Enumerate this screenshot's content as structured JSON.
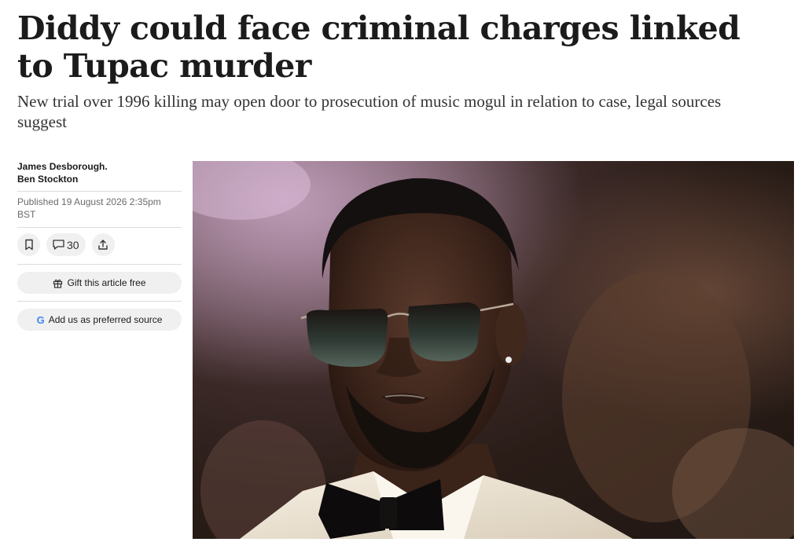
{
  "article": {
    "headline": "Diddy could face criminal charges linked to Tupac murder",
    "standfirst": "New trial over 1996 killing may open door to prosecution of music mogul in relation to case, legal sources suggest",
    "byline_line1": "James Desborough.",
    "byline_line2": "Ben Stockton",
    "published": "Published 19 August 2026 2:35pm BST"
  },
  "actions": {
    "bookmark_icon": "bookmark-icon",
    "comment_icon": "comment-icon",
    "comment_count": "30",
    "share_icon": "share-icon",
    "gift_label": "Gift this article free",
    "gift_icon": "gift-icon",
    "preferred_source_label": "Add us as preferred source",
    "google_icon": "google-icon",
    "google_letter": "G"
  },
  "image": {
    "subject": "photo-of-man-in-sunglasses-and-white-tuxedo"
  },
  "colors": {
    "text": "#1b1b1b",
    "muted": "#6b6b6b",
    "button_bg": "#f0f0f0",
    "google_blue": "#4285f4"
  }
}
